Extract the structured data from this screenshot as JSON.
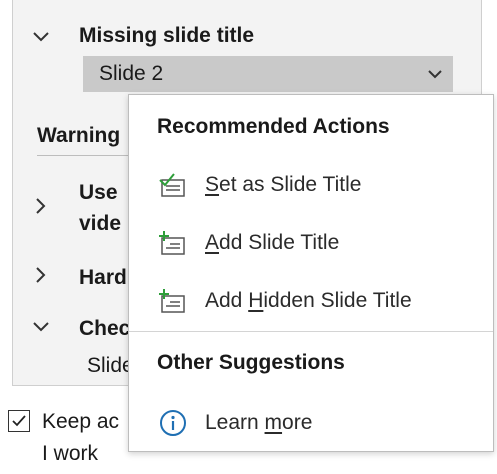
{
  "pane": {
    "issue_title": "Missing slide title",
    "selected_slide": "Slide 2",
    "warnings_label": "Warning",
    "items": [
      {
        "line1": "Use",
        "line2": "vide"
      },
      {
        "line1": "Hard"
      },
      {
        "line1": "Chec",
        "sub": "Slide"
      }
    ]
  },
  "keep_active": {
    "line1": "Keep ac",
    "line2": "I work",
    "checked": true
  },
  "menu": {
    "recommended_heading": "Recommended Actions",
    "items": [
      {
        "pre": "",
        "key": "S",
        "post": "et as Slide Title",
        "icon": "set-as-title-icon"
      },
      {
        "pre": "",
        "key": "A",
        "post": "dd Slide Title",
        "icon": "add-title-icon"
      },
      {
        "pre": "Add ",
        "key": "H",
        "post": "idden Slide Title",
        "icon": "add-hidden-title-icon"
      }
    ],
    "other_heading": "Other Suggestions",
    "learn_more": {
      "pre": "Learn ",
      "key": "m",
      "post": "ore",
      "icon": "info-icon"
    }
  },
  "colors": {
    "accent_green": "#2e9e3a",
    "info_blue": "#1f6fb3",
    "icon_gray": "#555555"
  }
}
